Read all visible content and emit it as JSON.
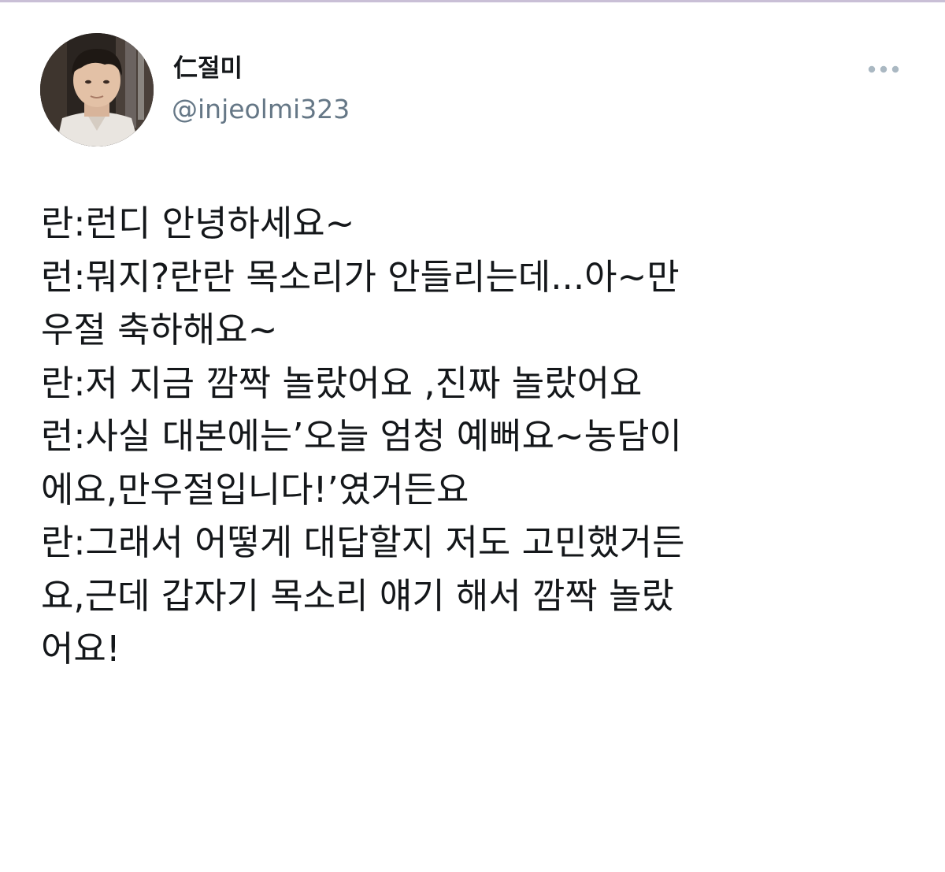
{
  "tweet": {
    "author": {
      "display_name": "仁절미",
      "handle": "@injeolmi323",
      "avatar_icon": "profile-photo"
    },
    "more_icon": "more-options-icon",
    "text_lines": [
      "란:런디 안녕하세요~",
      "런:뭐지?란란 목소리가 안들리는데...아~만",
      "우절 축하해요~",
      "란:저 지금 깜짝 놀랐어요 ,진짜 놀랐어요",
      "런:사실 대본에는’오늘 엄청 예뻐요~농담이",
      "에요,만우절입니다!’였거든요",
      "란:그래서 어떻게 대답할지 저도 고민했거든",
      "요,근데 갑자기 목소리 얘기 해서 깜짝 놀랐",
      "어요!"
    ]
  },
  "colors": {
    "text": "#14171a",
    "secondary_text": "#657786",
    "more_icon": "#aab8c2"
  }
}
